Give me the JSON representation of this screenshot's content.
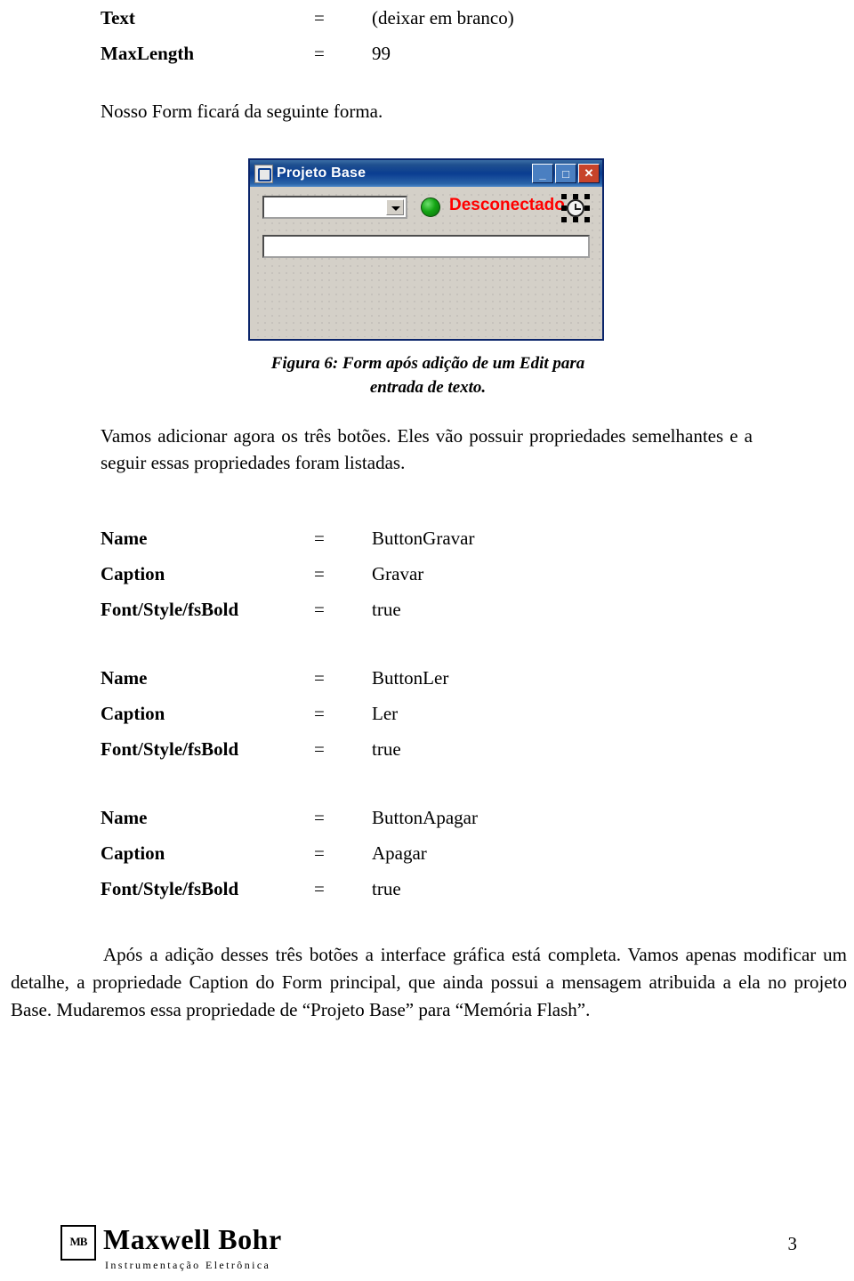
{
  "top_properties": [
    {
      "label": "Text",
      "eq": "=",
      "value": "(deixar em branco)"
    },
    {
      "label": "MaxLength",
      "eq": "=",
      "value": "99"
    }
  ],
  "paragraphs": {
    "intro": "Nosso Form ficará da seguinte forma.",
    "after_figure": "Vamos adicionar agora os três botões. Eles vão possuir propriedades semelhantes e a seguir essas propriedades foram listadas.",
    "closing": "Após a adição desses três botões a interface gráfica está completa. Vamos apenas modificar um detalhe, a propriedade Caption do Form principal, que ainda possui a mensagem atribuida a ela no projeto Base. Mudaremos essa propriedade de “Projeto Base” para “Memória Flash”."
  },
  "figure": {
    "caption_line1": "Figura 6: Form após adição de um Edit para",
    "caption_line2": "entrada de texto.",
    "window": {
      "title": "Projeto Base",
      "minimize_label": "_",
      "maximize_label": "□",
      "close_label": "✕",
      "combo_value": "",
      "edit_value": "",
      "status_text": "Desconectado",
      "led_color": "#14a514",
      "status_color": "#ff0000",
      "titlebar_color": "#0a3d91"
    }
  },
  "button_groups": [
    {
      "rows": [
        {
          "label": "Name",
          "eq": "=",
          "value": "ButtonGravar"
        },
        {
          "label": "Caption",
          "eq": "=",
          "value": "Gravar"
        },
        {
          "label": "Font/Style/fsBold",
          "eq": "=",
          "value": "true"
        }
      ]
    },
    {
      "rows": [
        {
          "label": "Name",
          "eq": "=",
          "value": "ButtonLer"
        },
        {
          "label": "Caption",
          "eq": "=",
          "value": "Ler"
        },
        {
          "label": "Font/Style/fsBold",
          "eq": "=",
          "value": "true"
        }
      ]
    },
    {
      "rows": [
        {
          "label": "Name",
          "eq": "=",
          "value": "ButtonApagar"
        },
        {
          "label": "Caption",
          "eq": "=",
          "value": "Apagar"
        },
        {
          "label": "Font/Style/fsBold",
          "eq": "=",
          "value": "true"
        }
      ]
    }
  ],
  "footer": {
    "logo_mark_text": "MB",
    "logo_name": "Maxwell Bohr",
    "logo_subtitle": "Instrumentação Eletrônica",
    "page_number": "3"
  }
}
